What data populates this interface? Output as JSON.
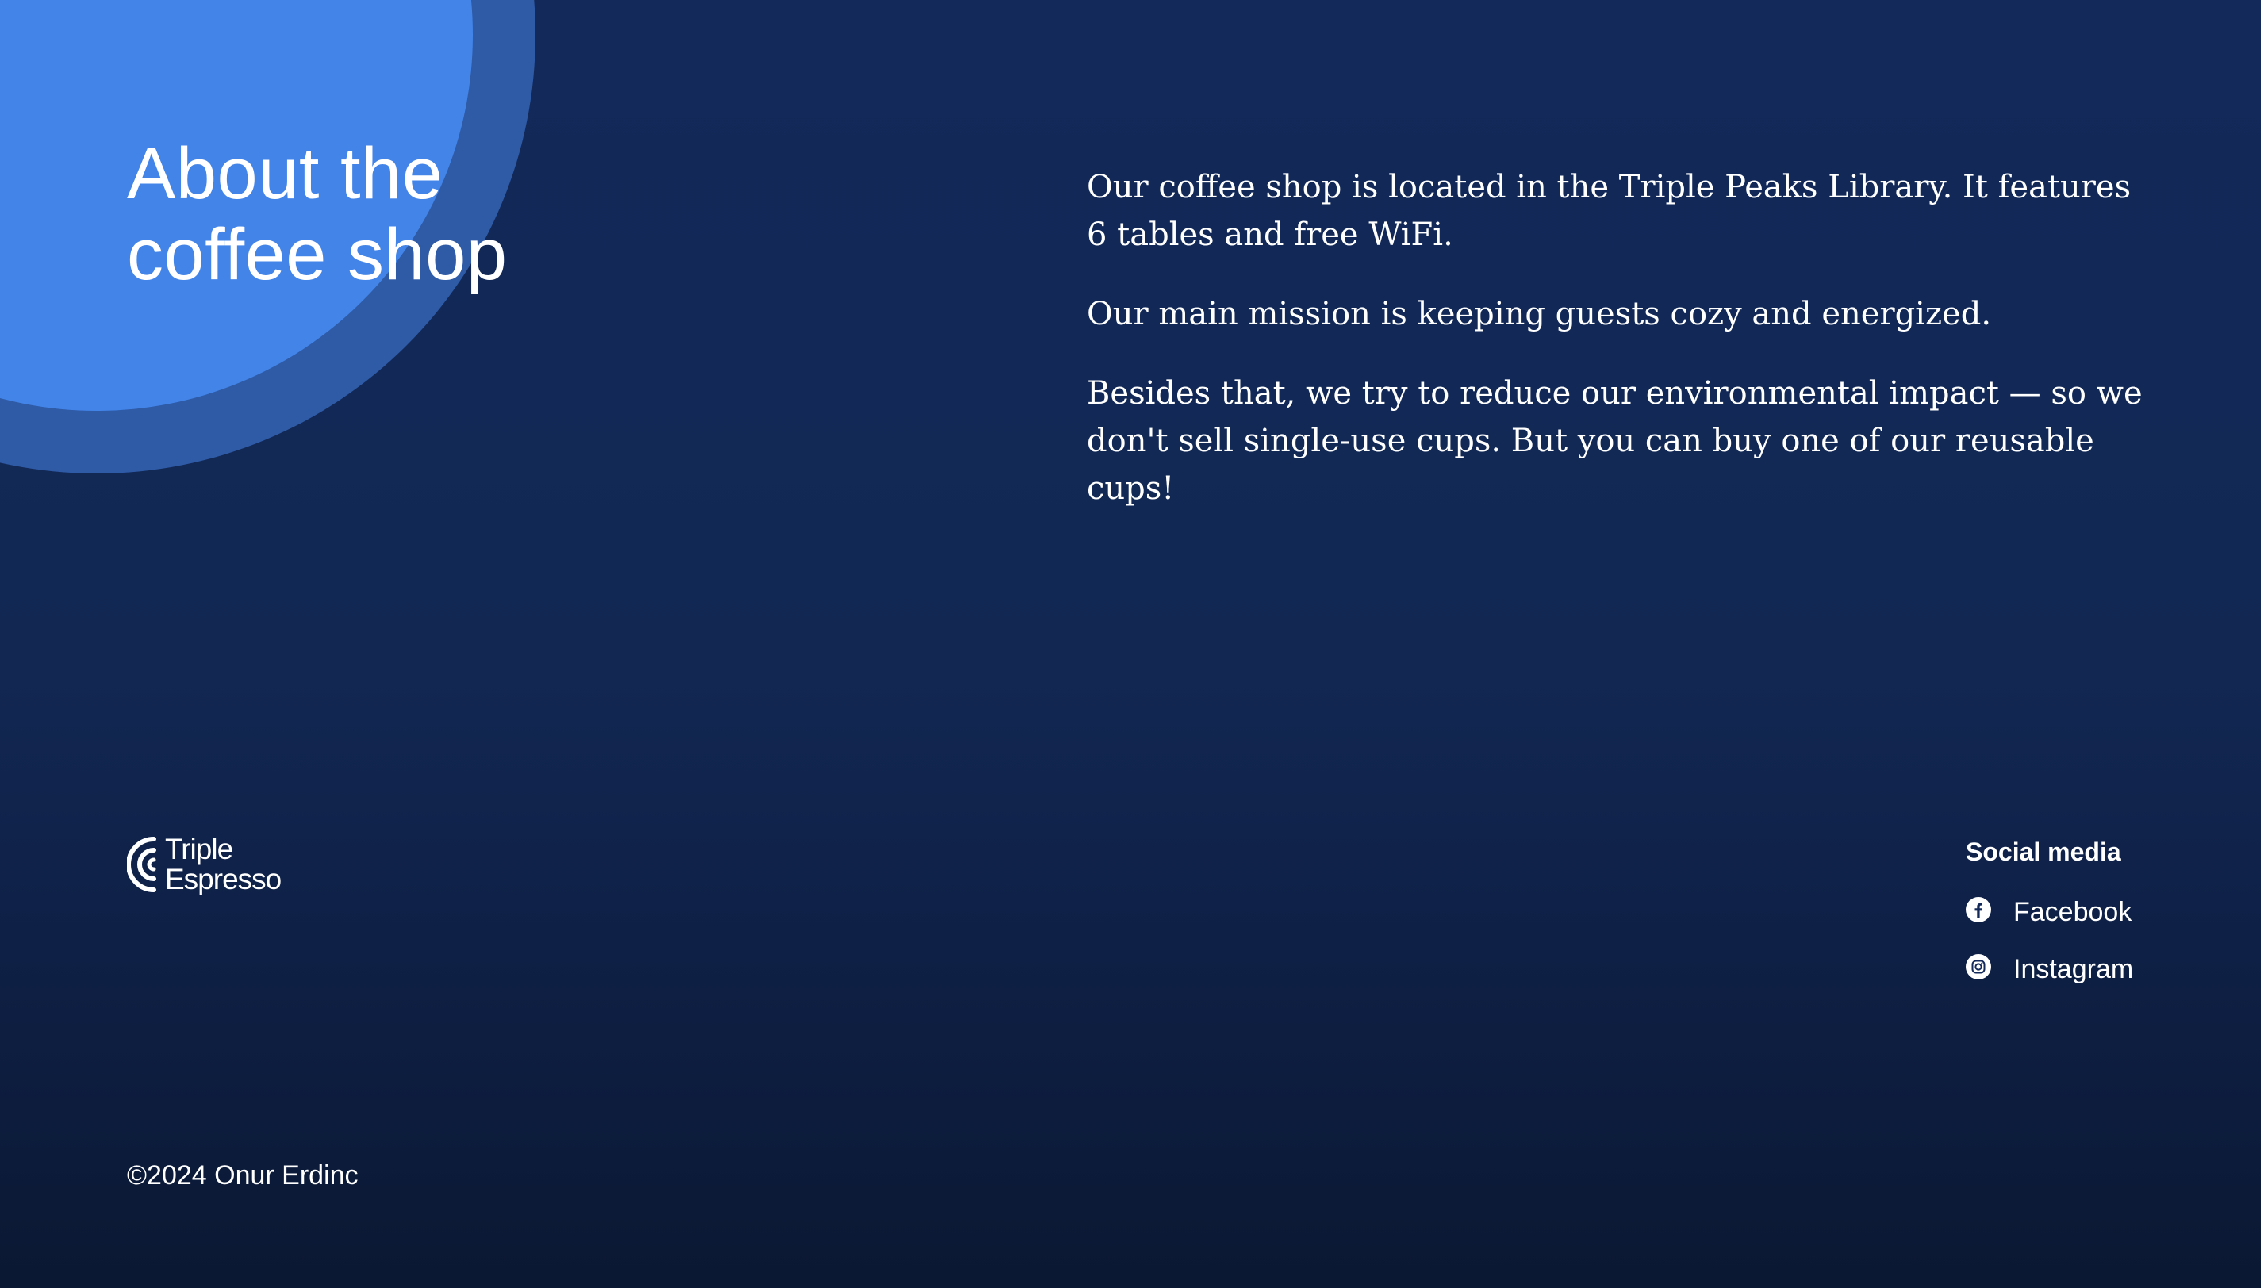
{
  "hero": {
    "title_line1": "About the",
    "title_line2": "coffee shop"
  },
  "about": {
    "paragraphs": [
      "Our coffee shop is located in the Triple Peaks Library. It features 6 tables and free WiFi.",
      "Our main mission is keeping guests cozy and energized.",
      "Besides that, we try to reduce our environmental impact — so we don't sell single-use cups. But you can buy one of our reusable cups!"
    ]
  },
  "logo": {
    "line1": "Triple",
    "line2": "Espresso",
    "icon": "coffee-waves-logo"
  },
  "social": {
    "heading": "Social media",
    "links": [
      {
        "label": "Facebook",
        "icon": "facebook-icon"
      },
      {
        "label": "Instagram",
        "icon": "instagram-icon"
      }
    ]
  },
  "footer": {
    "copyright": "©2024 Onur Erdinc"
  },
  "colors": {
    "background": "#12295a",
    "circle_inner": "#4284e8",
    "circle_outer": "#2e5aa6",
    "text": "#ffffff"
  }
}
